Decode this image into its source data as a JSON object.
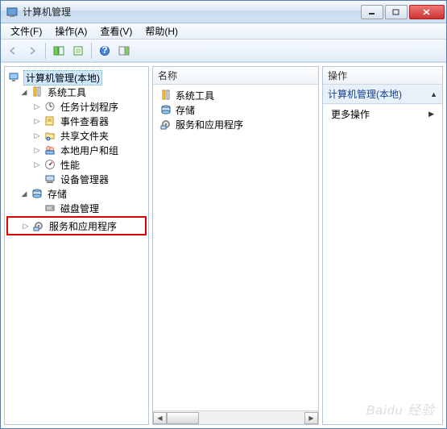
{
  "window": {
    "title": "计算机管理"
  },
  "menu": {
    "file": "文件(F)",
    "action": "操作(A)",
    "view": "查看(V)",
    "help": "帮助(H)"
  },
  "toolbar": {
    "back": "back",
    "forward": "forward",
    "up": "up",
    "show_hide": "show-hide",
    "properties": "properties",
    "help": "help",
    "refresh": "refresh"
  },
  "tree": {
    "root": "计算机管理(本地)",
    "system_tools": "系统工具",
    "task_scheduler": "任务计划程序",
    "event_viewer": "事件查看器",
    "shared_folders": "共享文件夹",
    "local_users": "本地用户和组",
    "performance": "性能",
    "device_manager": "设备管理器",
    "storage": "存储",
    "disk_management": "磁盘管理",
    "services_apps": "服务和应用程序"
  },
  "list": {
    "header": "名称",
    "items": {
      "system_tools": "系统工具",
      "storage": "存储",
      "services_apps": "服务和应用程序"
    }
  },
  "actions": {
    "header": "操作",
    "section": "计算机管理(本地)",
    "more": "更多操作"
  },
  "watermark": "Baidu 经验"
}
